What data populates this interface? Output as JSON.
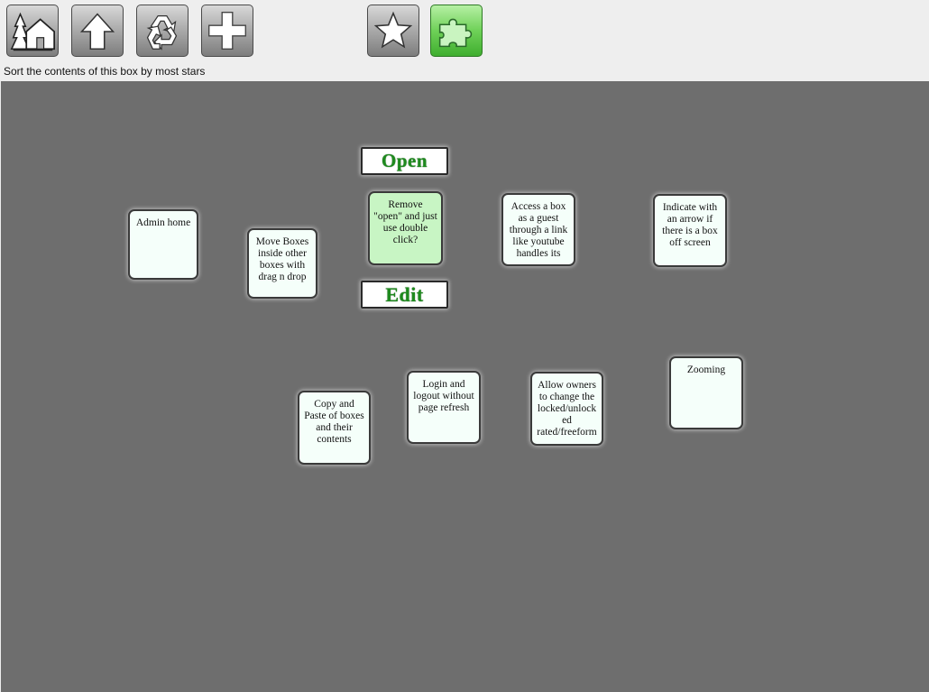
{
  "toolbar": {
    "buttons": [
      {
        "icon": "home-tree-icon"
      },
      {
        "icon": "arrow-up-icon"
      },
      {
        "icon": "recycle-icon"
      },
      {
        "icon": "plus-icon"
      },
      {
        "icon": "star-icon"
      },
      {
        "icon": "puzzle-icon",
        "active": true
      }
    ],
    "hint": "Sort the contents of this box by most stars"
  },
  "actions": {
    "open": "Open",
    "edit": "Edit"
  },
  "cards": [
    {
      "id": "admin-home",
      "text": "Admin home"
    },
    {
      "id": "move-boxes",
      "text": "Move Boxes inside other boxes with drag n drop"
    },
    {
      "id": "remove-open",
      "text": "Remove \"open\" and just use double click?",
      "selected": true
    },
    {
      "id": "guest-access",
      "text": "Access a box as a guest through a link like youtube handles its"
    },
    {
      "id": "offscreen-arrow",
      "text": "Indicate with an arrow if there is a box off screen"
    },
    {
      "id": "copy-paste",
      "text": "Copy and Paste of boxes and their contents"
    },
    {
      "id": "login-logout",
      "text": "Login  and logout without page refresh"
    },
    {
      "id": "owner-lock",
      "text": "Allow owners to change the locked/unlocked rated/freeform"
    },
    {
      "id": "zooming",
      "text": "Zooming"
    }
  ],
  "colors": {
    "canvas": "#6e6e6e",
    "card": "#f5fffa",
    "card_selected": "#c8f5c4",
    "action_text": "#1e8a1e",
    "toolbar_active": "#6fd158"
  }
}
